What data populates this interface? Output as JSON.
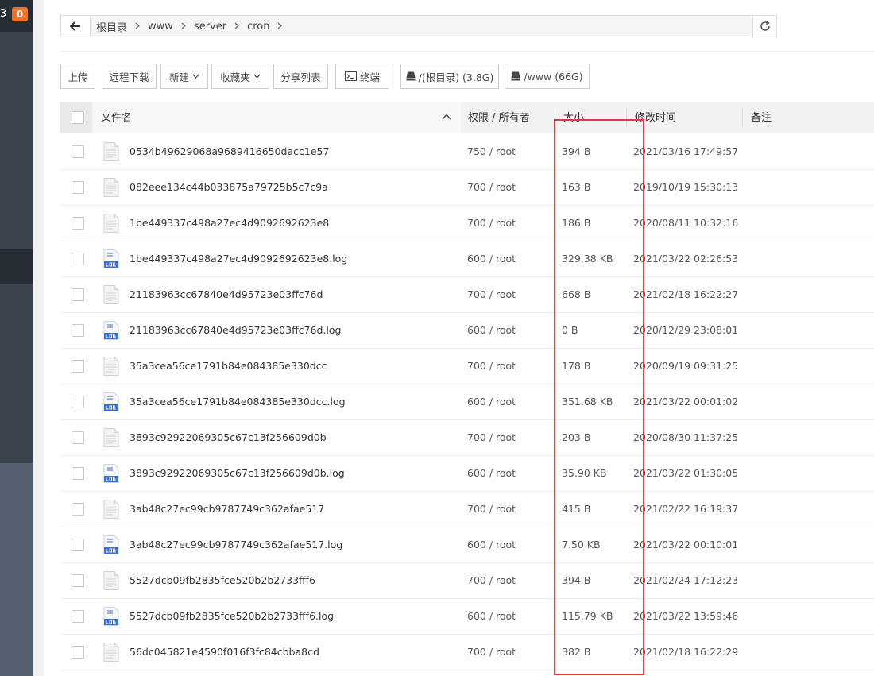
{
  "sidebar": {
    "tail_number": "3",
    "badge_count": "0"
  },
  "breadcrumb": [
    "根目录",
    "www",
    "server",
    "cron"
  ],
  "toolbar": {
    "upload": "上传",
    "remote_download": "远程下载",
    "new": "新建",
    "favorites": "收藏夹",
    "share_list": "分享列表",
    "terminal": "终端",
    "disk_root": "/(根目录) (3.8G)",
    "disk_www": "/www (66G)"
  },
  "table": {
    "headers": {
      "name": "文件名",
      "perm": "权限 / 所有者",
      "size": "大小",
      "mtime": "修改时间",
      "note": "备注"
    },
    "rows": [
      {
        "name": "0534b49629068a9689416650dacc1e57",
        "type": "file",
        "perm": "750 / root",
        "size": "394 B",
        "mtime": "2021/03/16 17:49:57"
      },
      {
        "name": "082eee134c44b033875a79725b5c7c9a",
        "type": "file",
        "perm": "700 / root",
        "size": "163 B",
        "mtime": "2019/10/19 15:30:13"
      },
      {
        "name": "1be449337c498a27ec4d9092692623e8",
        "type": "file",
        "perm": "700 / root",
        "size": "186 B",
        "mtime": "2020/08/11 10:32:16"
      },
      {
        "name": "1be449337c498a27ec4d9092692623e8.log",
        "type": "log",
        "perm": "600 / root",
        "size": "329.38 KB",
        "mtime": "2021/03/22 02:26:53"
      },
      {
        "name": "21183963cc67840e4d95723e03ffc76d",
        "type": "file",
        "perm": "700 / root",
        "size": "668 B",
        "mtime": "2021/02/18 16:22:27"
      },
      {
        "name": "21183963cc67840e4d95723e03ffc76d.log",
        "type": "log",
        "perm": "600 / root",
        "size": "0 B",
        "mtime": "2020/12/29 23:08:01"
      },
      {
        "name": "35a3cea56ce1791b84e084385e330dcc",
        "type": "file",
        "perm": "700 / root",
        "size": "178 B",
        "mtime": "2020/09/19 09:31:25"
      },
      {
        "name": "35a3cea56ce1791b84e084385e330dcc.log",
        "type": "log",
        "perm": "600 / root",
        "size": "351.68 KB",
        "mtime": "2021/03/22 00:01:02"
      },
      {
        "name": "3893c92922069305c67c13f256609d0b",
        "type": "file",
        "perm": "700 / root",
        "size": "203 B",
        "mtime": "2020/08/30 11:37:25"
      },
      {
        "name": "3893c92922069305c67c13f256609d0b.log",
        "type": "log",
        "perm": "600 / root",
        "size": "35.90 KB",
        "mtime": "2021/03/22 01:30:05"
      },
      {
        "name": "3ab48c27ec99cb9787749c362afae517",
        "type": "file",
        "perm": "700 / root",
        "size": "415 B",
        "mtime": "2021/02/22 16:19:37"
      },
      {
        "name": "3ab48c27ec99cb9787749c362afae517.log",
        "type": "log",
        "perm": "600 / root",
        "size": "7.50 KB",
        "mtime": "2021/03/22 00:10:01"
      },
      {
        "name": "5527dcb09fb2835fce520b2b2733fff6",
        "type": "file",
        "perm": "700 / root",
        "size": "394 B",
        "mtime": "2021/02/24 17:12:23"
      },
      {
        "name": "5527dcb09fb2835fce520b2b2733fff6.log",
        "type": "log",
        "perm": "600 / root",
        "size": "115.79 KB",
        "mtime": "2021/03/22 13:59:46"
      },
      {
        "name": "56dc045821e4590f016f3fc84cbba8cd",
        "type": "file",
        "perm": "700 / root",
        "size": "382 B",
        "mtime": "2021/02/18 16:22:29"
      }
    ]
  },
  "colors": {
    "sidebar": "#3c444d",
    "badge": "#f0722c",
    "highlight": "#e03a3a"
  }
}
